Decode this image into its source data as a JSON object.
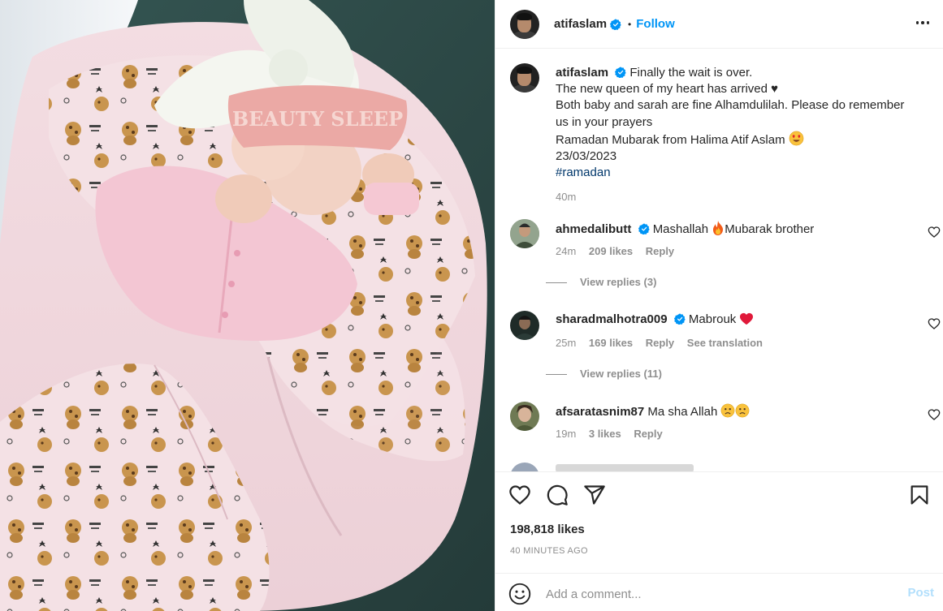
{
  "post": {
    "image_alt_icon": "newborn-photo",
    "eye_mask_text": "BEAUTY SLEEP",
    "accent_color": "#0095f6"
  },
  "header": {
    "username": "atifaslam",
    "separator": "•",
    "follow_label": "Follow",
    "more_icon": "more-horizontal-icon"
  },
  "caption": {
    "username": "atifaslam",
    "lines": [
      "Finally the wait is over.",
      "The new queen of my heart has arrived ♥",
      "Both baby and sarah are fine Alhamdulilah. Please do remember",
      "us in your prayers",
      "Ramadan Mubarak from Halima Atif Aslam",
      "23/03/2023"
    ],
    "hashtag": "#ramadan",
    "time": "40m"
  },
  "comments": [
    {
      "username": "ahmedalibutt",
      "verified": true,
      "text_before": "Mashallah ",
      "text_after": "Mubarak brother",
      "time": "24m",
      "likes": "209 likes",
      "reply": "Reply",
      "view_replies": "View replies (3)"
    },
    {
      "username": "sharadmalhotra009",
      "verified": true,
      "text_before": "Mabrouk ",
      "text_after": "",
      "time": "25m",
      "likes": "169 likes",
      "reply": "Reply",
      "translation": "See translation",
      "view_replies": "View replies (11)"
    },
    {
      "username": "afsaratasnim87",
      "verified": false,
      "text_before": "Ma sha Allah ",
      "text_after": "",
      "time": "19m",
      "likes": "3 likes",
      "reply": "Reply"
    }
  ],
  "actions": {
    "like_icon": "heart-icon",
    "comment_icon": "comment-icon",
    "share_icon": "share-icon",
    "save_icon": "bookmark-icon",
    "likes_count": "198,818 likes",
    "posted_time": "40 MINUTES AGO"
  },
  "composer": {
    "placeholder": "Add a comment...",
    "post_label": "Post"
  }
}
